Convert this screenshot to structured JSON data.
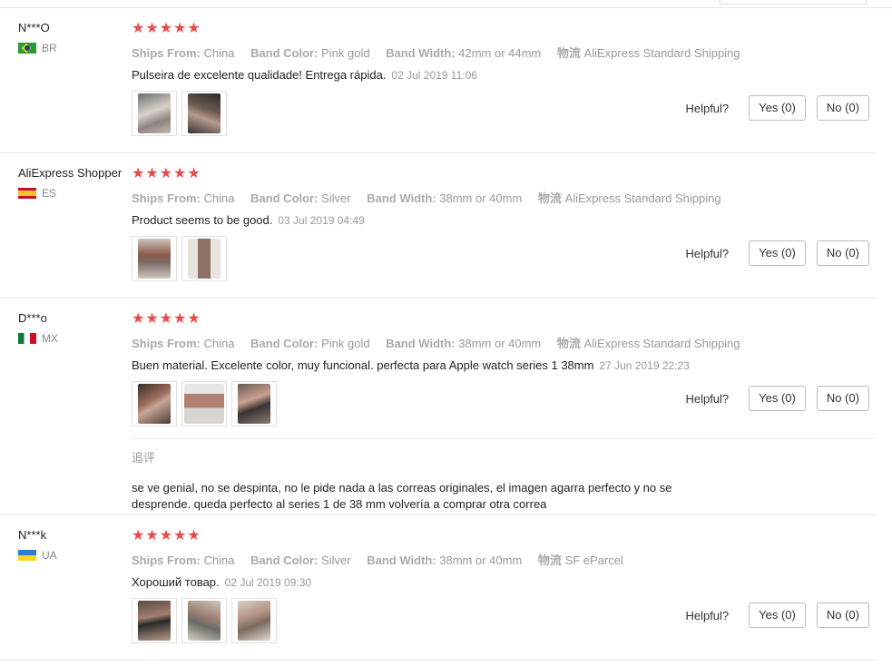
{
  "helpful_label": "Helpful?",
  "labels": {
    "ships_from": "Ships From:",
    "band_color": "Band Color:",
    "band_width": "Band Width:",
    "shipping": "物流"
  },
  "stars": "★★★★★",
  "reviews": [
    {
      "user": "N***O",
      "country": "BR",
      "ships_from": "China",
      "band_color": "Pink gold",
      "band_width": "42mm or 44mm",
      "shipping": "AliExpress Standard Shipping",
      "text": "Pulseira de excelente qualidade! Entrega rápida.",
      "date": "02 Jul 2019 11:06",
      "yes": "Yes (0)",
      "no": "No (0)"
    },
    {
      "user": "AliExpress Shopper",
      "country": "ES",
      "ships_from": "China",
      "band_color": "Silver",
      "band_width": "38mm or 40mm",
      "shipping": "AliExpress Standard Shipping",
      "text": "Product seems to be good.",
      "date": "03 Jul 2019 04:49",
      "yes": "Yes (0)",
      "no": "No (0)"
    },
    {
      "user": "D***o",
      "country": "MX",
      "ships_from": "China",
      "band_color": "Pink gold",
      "band_width": "38mm or 40mm",
      "shipping": "AliExpress Standard Shipping",
      "text": "Buen material. Excelente color, muy funcional. perfecta para Apple watch series 1 38mm",
      "date": "27 Jun 2019 22:23",
      "yes": "Yes (0)",
      "no": "No (0)",
      "followup_title": "追评",
      "followup_text": "se ve genial, no se despinta, no le pide nada a las correas originales, el imagen agarra perfecto y no se desprende. queda perfecto al series 1 de 38 mm volvería a comprar otra correa"
    },
    {
      "user": "N***k",
      "country": "UA",
      "ships_from": "China",
      "band_color": "Silver",
      "band_width": "38mm or 40mm",
      "shipping": "SF eParcel",
      "text": "Хороший товар.",
      "date": "02 Jul 2019 09:30",
      "yes": "Yes (0)",
      "no": "No (0)"
    }
  ],
  "colors": {
    "star": "#ea4a4a",
    "muted": "#999999",
    "border": "#e8e8e8"
  }
}
